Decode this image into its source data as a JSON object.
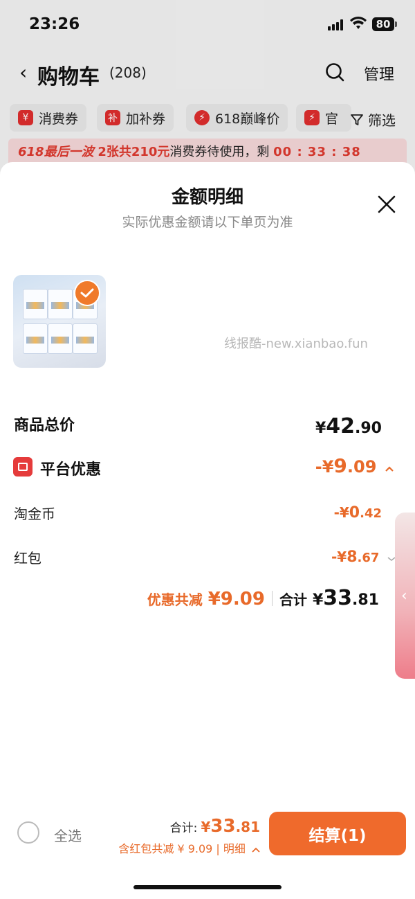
{
  "status_bar": {
    "time": "23:26",
    "battery": "80"
  },
  "nav": {
    "title": "购物车",
    "count": "(208)",
    "manage": "管理"
  },
  "chips": [
    {
      "icon_char": "¥",
      "label": "消费券"
    },
    {
      "icon_char": "补",
      "label": "加补券"
    },
    {
      "icon_char": "⚡",
      "label": "618巅峰价"
    },
    {
      "icon_char": "⚡",
      "label": "官"
    }
  ],
  "filter_label": "筛选",
  "promo_bar": {
    "tag": "618最后一波",
    "highlight": "2张共210元",
    "text": "消费券待使用，剩",
    "timer": "00 : 33 : 38"
  },
  "sheet": {
    "title": "金额明细",
    "subtitle": "实际优惠金额请以下单页为准",
    "watermark": "线报酷-new.xianbao.fun"
  },
  "rows": {
    "goods_total": {
      "label": "商品总价",
      "yen": "¥",
      "int": "42",
      "dec": ".90"
    },
    "platform_discount": {
      "label": "平台优惠",
      "prefix": "-¥",
      "int": "9",
      "dec": ".09"
    },
    "taojinbi": {
      "label": "淘金币",
      "prefix": "-¥",
      "int": "0",
      "dec": ".42"
    },
    "hongbao": {
      "label": "红包",
      "prefix": "-¥",
      "int": "8",
      "dec": ".67"
    }
  },
  "summary": {
    "discount_label": "优惠共减",
    "discount_value": "¥9.09",
    "total_label": "合计",
    "total_yen": "¥",
    "total_int": "33",
    "total_dec": ".81"
  },
  "bottom_bar": {
    "select_all": "全选",
    "total_label": "合计:",
    "total_yen": "¥",
    "total_int": "33",
    "total_dec": ".81",
    "detail_text": "含红包共减 ¥ 9.09 | 明细",
    "checkout_label": "结算(1)"
  },
  "colors": {
    "accent": "#ef6a2c",
    "discount": "#e86a2a",
    "red": "#e03a2f"
  },
  "icons": [
    "back-icon",
    "search-icon",
    "filter-icon",
    "close-icon",
    "check-icon",
    "platform-discount-icon",
    "chevron-up-icon",
    "chevron-down-icon",
    "chevron-left-icon"
  ]
}
